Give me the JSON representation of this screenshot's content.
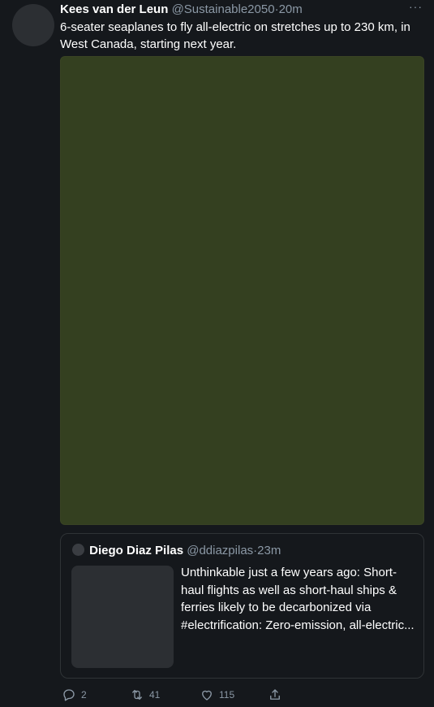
{
  "tweet": {
    "author_name": "Kees van der Leun",
    "author_handle": "@Sustainable2050",
    "separator": "·",
    "time": "20m",
    "more": "···",
    "text": "6-seater seaplanes to fly all-electric on stretches up to 230 km, in West Canada, starting next year."
  },
  "quoted_tweet": {
    "author_name": "Diego Diaz Pilas",
    "author_handle": "@ddiazpilas",
    "separator": "·",
    "time": "23m",
    "text": "Unthinkable just a few years ago: Short-haul flights as well as short-haul ships & ferries likely to be decarbonized via #electrification: Zero-emission, all-electric..."
  },
  "actions": {
    "reply_count": "2",
    "retweet_count": "41",
    "like_count": "115",
    "reply_icon": "reply-icon",
    "retweet_icon": "retweet-icon",
    "like_icon": "heart-icon",
    "share_icon": "share-icon"
  },
  "colors": {
    "background": "#15181c",
    "media_green": "#344020",
    "muted_text": "#8b98a5"
  }
}
